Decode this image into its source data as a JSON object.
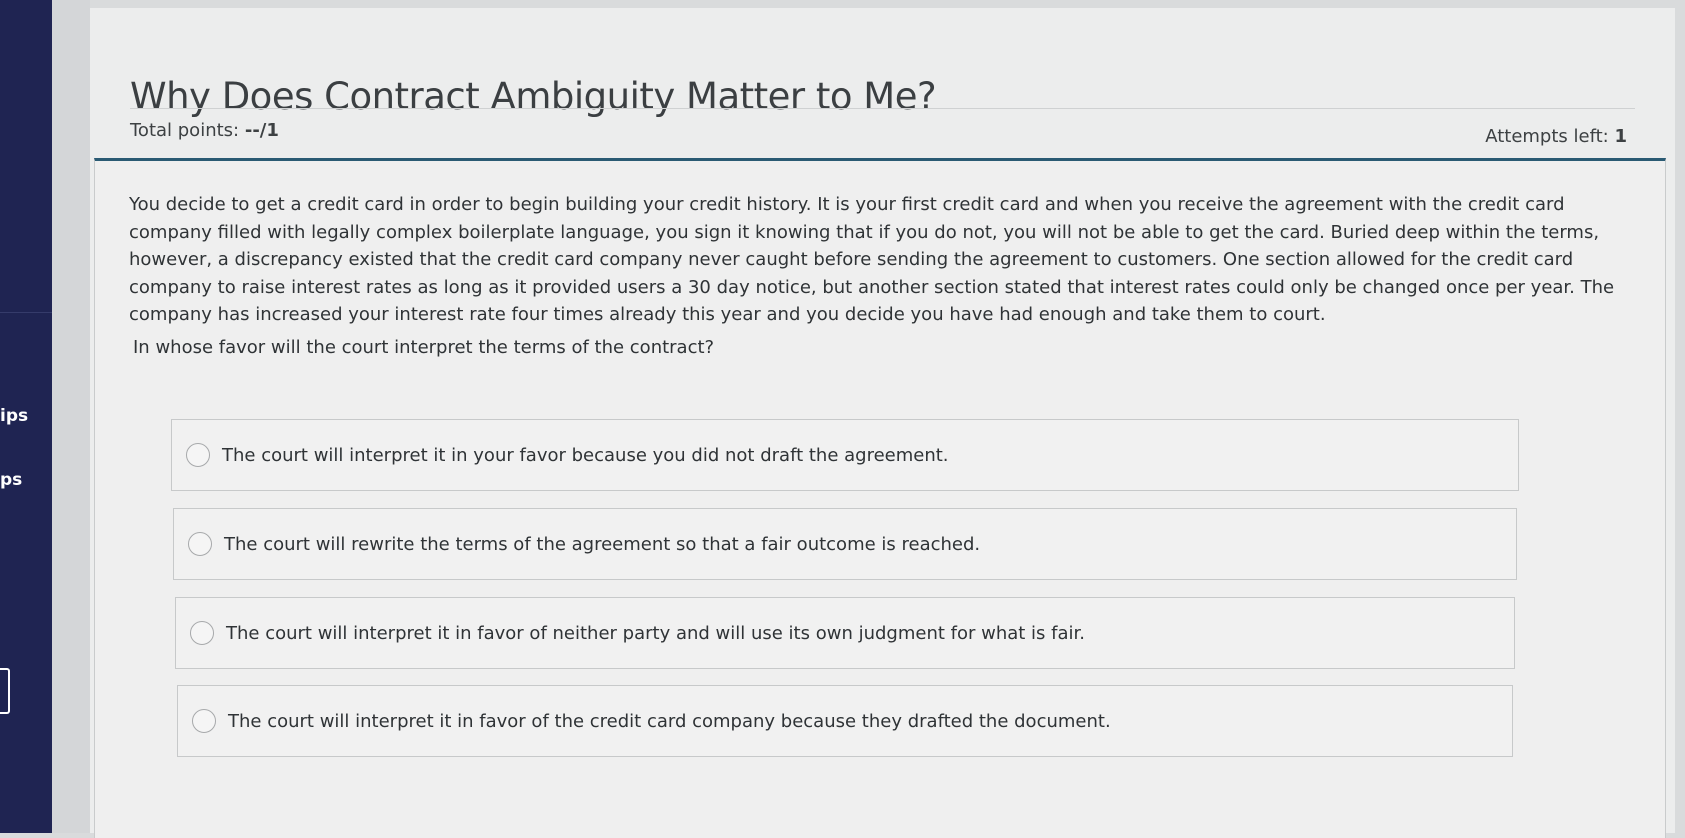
{
  "sidebar": {
    "items": [
      "ips",
      "ps"
    ]
  },
  "page": {
    "title": "Why Does Contract Ambiguity Matter to Me?",
    "total_points_label": "Total points:",
    "total_points_value": "--/1",
    "attempts_label": "Attempts left:",
    "attempts_value": "1"
  },
  "question": {
    "prompt": "You decide to get a credit card in order to begin building your credit history. It is your first credit card and when you receive the agreement with the credit card company filled with legally complex boilerplate language, you sign it knowing that if you do not, you will not be able to get the card. Buried deep within the terms, however, a discrepancy existed that the credit card company never caught before sending the agreement to customers. One section allowed for the credit card company to raise interest rates as long as it provided users a 30 day notice, but another section stated that interest rates could only be changed once per year. The company has increased your interest rate four times already this year and you decide you have had enough and take them to court.",
    "text": "In whose favor will the court interpret the terms of the contract?",
    "options": [
      {
        "label": "The court will interpret it in your favor because you did not draft the agreement.",
        "selected": false
      },
      {
        "label": "The court will rewrite the terms of the agreement so that a fair outcome is reached.",
        "selected": false
      },
      {
        "label": "The court will interpret it in favor of neither party and will use its own judgment for what is fair.",
        "selected": false
      },
      {
        "label": "The court will interpret it in favor of the credit card company because they drafted the document.",
        "selected": false
      }
    ]
  },
  "colors": {
    "sidebar": "#1f2452",
    "panel_accent": "#2a5a73",
    "background": "#eceded"
  }
}
